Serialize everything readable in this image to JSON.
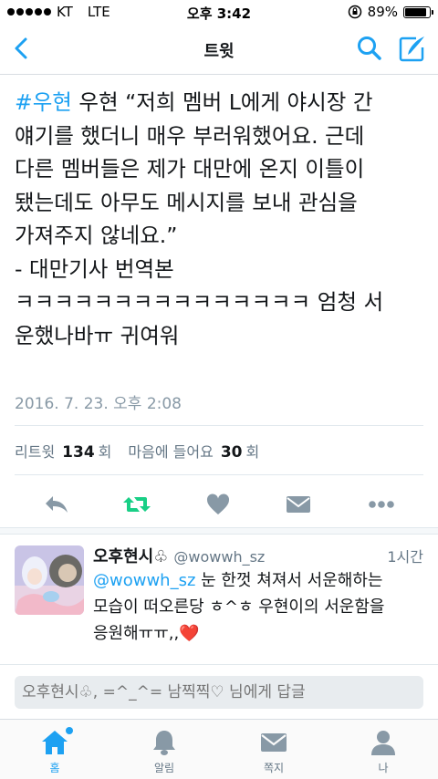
{
  "status_bar": {
    "carrier": "KT",
    "network": "LTE",
    "time": "오후 3:42",
    "battery": "89%",
    "battery_level": 0.89
  },
  "nav": {
    "title": "트윗",
    "back_icon": "chevron-left-icon",
    "search_icon": "search-icon",
    "compose_icon": "compose-icon"
  },
  "tweet": {
    "hashtag": "#우현",
    "line1_rest": " 우현 “저희 멤버 L에게 야시장 간",
    "line2": "얘기를 했더니 매우 부러워했어요. 근데",
    "line3": "다른 멤버들은 제가 대만에 온지 이틀이",
    "line4": "됐는데도 아무도 메시지를 보내 관심을",
    "line5": "가져주지 않네요.”",
    "line6": "- 대만기사 번역본",
    "line7": "ㅋㅋㅋㅋㅋㅋㅋㅋㅋㅋㅋㅋㅋㅋㅋ 엄청 서",
    "line8": "운했나바ㅠ 귀여워",
    "date": "2016. 7. 23. 오후 2:08"
  },
  "stats": {
    "retweets_label": "리트윗",
    "retweets_count": "134",
    "retweets_unit": "회",
    "likes_label": "마음에 들어요",
    "likes_count": "30",
    "likes_unit": "회"
  },
  "actions": [
    "reply-icon",
    "retweet-icon",
    "heart-icon",
    "message-icon",
    "more-icon"
  ],
  "reply": {
    "name": "오후현시♧",
    "handle": "@wowwh_sz",
    "time": "1시간",
    "mention": "@wowwh_sz",
    "line1_rest": " 눈 한껏 쳐져서 서운해하는",
    "line2": "모습이 떠오른당 ㅎ^ㅎ 우현이의 서운함을",
    "line3": "응원해ㅠㅠ,,",
    "emoji": "❤️"
  },
  "reply_input": {
    "placeholder": "오후현시♧, =^_^= 남찍찍♡ 님에게 답글"
  },
  "tabs": [
    {
      "label": "홈",
      "icon": "home-icon",
      "active": true
    },
    {
      "label": "알림",
      "icon": "bell-icon",
      "active": false
    },
    {
      "label": "쪽지",
      "icon": "envelope-icon",
      "active": false
    },
    {
      "label": "나",
      "icon": "person-icon",
      "active": false
    }
  ],
  "colors": {
    "accent": "#1da1f2",
    "retweet_green": "#19cf86",
    "muted": "#8899a6"
  }
}
